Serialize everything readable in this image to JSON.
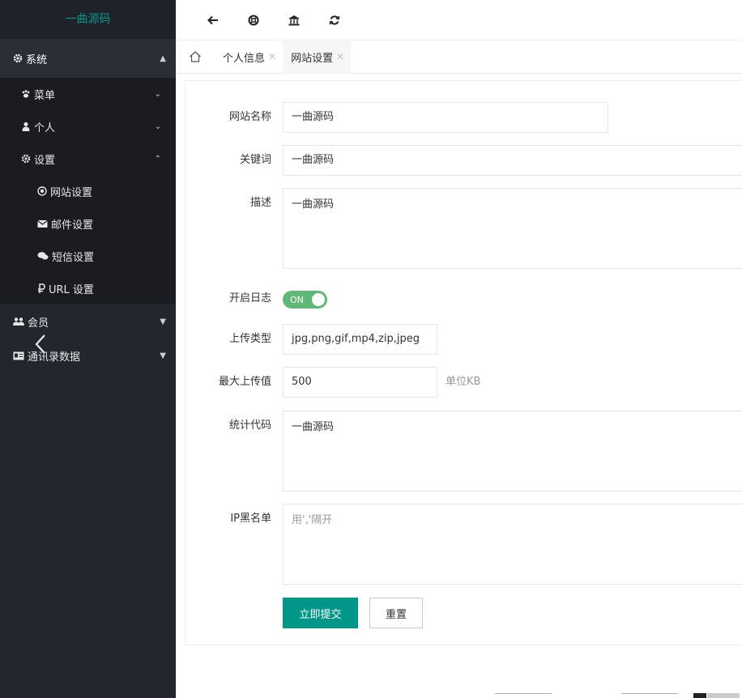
{
  "sidebar": {
    "logo": "一曲源码",
    "system": {
      "label": "系统",
      "icon": "gear-icon"
    },
    "sub_items": [
      {
        "label": "菜单",
        "icon": "paw-icon"
      },
      {
        "label": "个人",
        "icon": "user-icon"
      },
      {
        "label": "设置",
        "icon": "gear-icon"
      }
    ],
    "settings_children": [
      {
        "label": "网站设置",
        "icon": "target-icon"
      },
      {
        "label": "邮件设置",
        "icon": "envelope-icon"
      },
      {
        "label": "短信设置",
        "icon": "chat-icon"
      },
      {
        "label": "URL 设置",
        "icon": "ruble-icon"
      }
    ],
    "top_items": [
      {
        "label": "会员",
        "icon": "users-icon"
      },
      {
        "label": "通讯录数据",
        "icon": "card-icon"
      }
    ]
  },
  "header": {
    "icons": [
      "back-arrow-icon",
      "lifebuoy-icon",
      "bank-icon",
      "refresh-icon"
    ]
  },
  "tabs": [
    {
      "label": "个人信息",
      "active": false
    },
    {
      "label": "网站设置",
      "active": true
    }
  ],
  "form": {
    "site_name": {
      "label": "网站名称",
      "value": "一曲源码"
    },
    "keywords": {
      "label": "关键词",
      "value": "一曲源码"
    },
    "description": {
      "label": "描述",
      "value": "一曲源码"
    },
    "log_enabled": {
      "label": "开启日志",
      "switch_text": "ON"
    },
    "upload_types": {
      "label": "上传类型",
      "value": "jpg,png,gif,mp4,zip,jpeg"
    },
    "max_upload": {
      "label": "最大上传值",
      "value": "500",
      "unit": "单位KB"
    },
    "stats_code": {
      "label": "统计代码",
      "value": "一曲源码"
    },
    "ip_blacklist": {
      "label": "IP黑名单",
      "placeholder": "用','隔开"
    },
    "submit_label": "立即提交",
    "reset_label": "重置"
  },
  "colors": {
    "accent": "#009688",
    "switch_on": "#5fb878",
    "sidebar_bg": "#23262e"
  }
}
